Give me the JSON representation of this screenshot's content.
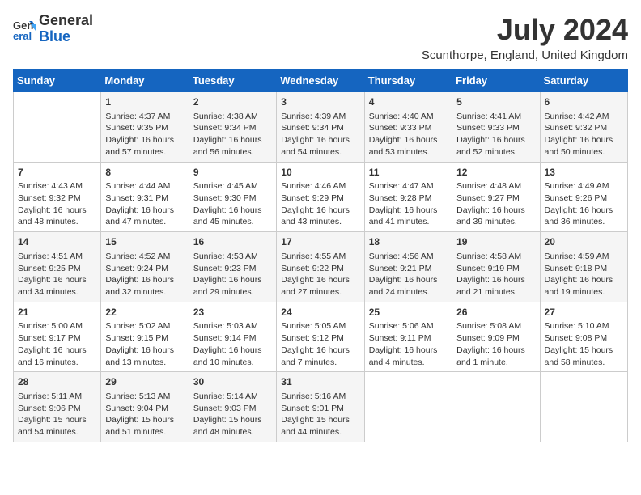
{
  "logo": {
    "general": "General",
    "blue": "Blue"
  },
  "title": "July 2024",
  "subtitle": "Scunthorpe, England, United Kingdom",
  "days_of_week": [
    "Sunday",
    "Monday",
    "Tuesday",
    "Wednesday",
    "Thursday",
    "Friday",
    "Saturday"
  ],
  "weeks": [
    [
      {
        "day": "",
        "info": ""
      },
      {
        "day": "1",
        "info": "Sunrise: 4:37 AM\nSunset: 9:35 PM\nDaylight: 16 hours\nand 57 minutes."
      },
      {
        "day": "2",
        "info": "Sunrise: 4:38 AM\nSunset: 9:34 PM\nDaylight: 16 hours\nand 56 minutes."
      },
      {
        "day": "3",
        "info": "Sunrise: 4:39 AM\nSunset: 9:34 PM\nDaylight: 16 hours\nand 54 minutes."
      },
      {
        "day": "4",
        "info": "Sunrise: 4:40 AM\nSunset: 9:33 PM\nDaylight: 16 hours\nand 53 minutes."
      },
      {
        "day": "5",
        "info": "Sunrise: 4:41 AM\nSunset: 9:33 PM\nDaylight: 16 hours\nand 52 minutes."
      },
      {
        "day": "6",
        "info": "Sunrise: 4:42 AM\nSunset: 9:32 PM\nDaylight: 16 hours\nand 50 minutes."
      }
    ],
    [
      {
        "day": "7",
        "info": "Sunrise: 4:43 AM\nSunset: 9:32 PM\nDaylight: 16 hours\nand 48 minutes."
      },
      {
        "day": "8",
        "info": "Sunrise: 4:44 AM\nSunset: 9:31 PM\nDaylight: 16 hours\nand 47 minutes."
      },
      {
        "day": "9",
        "info": "Sunrise: 4:45 AM\nSunset: 9:30 PM\nDaylight: 16 hours\nand 45 minutes."
      },
      {
        "day": "10",
        "info": "Sunrise: 4:46 AM\nSunset: 9:29 PM\nDaylight: 16 hours\nand 43 minutes."
      },
      {
        "day": "11",
        "info": "Sunrise: 4:47 AM\nSunset: 9:28 PM\nDaylight: 16 hours\nand 41 minutes."
      },
      {
        "day": "12",
        "info": "Sunrise: 4:48 AM\nSunset: 9:27 PM\nDaylight: 16 hours\nand 39 minutes."
      },
      {
        "day": "13",
        "info": "Sunrise: 4:49 AM\nSunset: 9:26 PM\nDaylight: 16 hours\nand 36 minutes."
      }
    ],
    [
      {
        "day": "14",
        "info": "Sunrise: 4:51 AM\nSunset: 9:25 PM\nDaylight: 16 hours\nand 34 minutes."
      },
      {
        "day": "15",
        "info": "Sunrise: 4:52 AM\nSunset: 9:24 PM\nDaylight: 16 hours\nand 32 minutes."
      },
      {
        "day": "16",
        "info": "Sunrise: 4:53 AM\nSunset: 9:23 PM\nDaylight: 16 hours\nand 29 minutes."
      },
      {
        "day": "17",
        "info": "Sunrise: 4:55 AM\nSunset: 9:22 PM\nDaylight: 16 hours\nand 27 minutes."
      },
      {
        "day": "18",
        "info": "Sunrise: 4:56 AM\nSunset: 9:21 PM\nDaylight: 16 hours\nand 24 minutes."
      },
      {
        "day": "19",
        "info": "Sunrise: 4:58 AM\nSunset: 9:19 PM\nDaylight: 16 hours\nand 21 minutes."
      },
      {
        "day": "20",
        "info": "Sunrise: 4:59 AM\nSunset: 9:18 PM\nDaylight: 16 hours\nand 19 minutes."
      }
    ],
    [
      {
        "day": "21",
        "info": "Sunrise: 5:00 AM\nSunset: 9:17 PM\nDaylight: 16 hours\nand 16 minutes."
      },
      {
        "day": "22",
        "info": "Sunrise: 5:02 AM\nSunset: 9:15 PM\nDaylight: 16 hours\nand 13 minutes."
      },
      {
        "day": "23",
        "info": "Sunrise: 5:03 AM\nSunset: 9:14 PM\nDaylight: 16 hours\nand 10 minutes."
      },
      {
        "day": "24",
        "info": "Sunrise: 5:05 AM\nSunset: 9:12 PM\nDaylight: 16 hours\nand 7 minutes."
      },
      {
        "day": "25",
        "info": "Sunrise: 5:06 AM\nSunset: 9:11 PM\nDaylight: 16 hours\nand 4 minutes."
      },
      {
        "day": "26",
        "info": "Sunrise: 5:08 AM\nSunset: 9:09 PM\nDaylight: 16 hours\nand 1 minute."
      },
      {
        "day": "27",
        "info": "Sunrise: 5:10 AM\nSunset: 9:08 PM\nDaylight: 15 hours\nand 58 minutes."
      }
    ],
    [
      {
        "day": "28",
        "info": "Sunrise: 5:11 AM\nSunset: 9:06 PM\nDaylight: 15 hours\nand 54 minutes."
      },
      {
        "day": "29",
        "info": "Sunrise: 5:13 AM\nSunset: 9:04 PM\nDaylight: 15 hours\nand 51 minutes."
      },
      {
        "day": "30",
        "info": "Sunrise: 5:14 AM\nSunset: 9:03 PM\nDaylight: 15 hours\nand 48 minutes."
      },
      {
        "day": "31",
        "info": "Sunrise: 5:16 AM\nSunset: 9:01 PM\nDaylight: 15 hours\nand 44 minutes."
      },
      {
        "day": "",
        "info": ""
      },
      {
        "day": "",
        "info": ""
      },
      {
        "day": "",
        "info": ""
      }
    ]
  ]
}
